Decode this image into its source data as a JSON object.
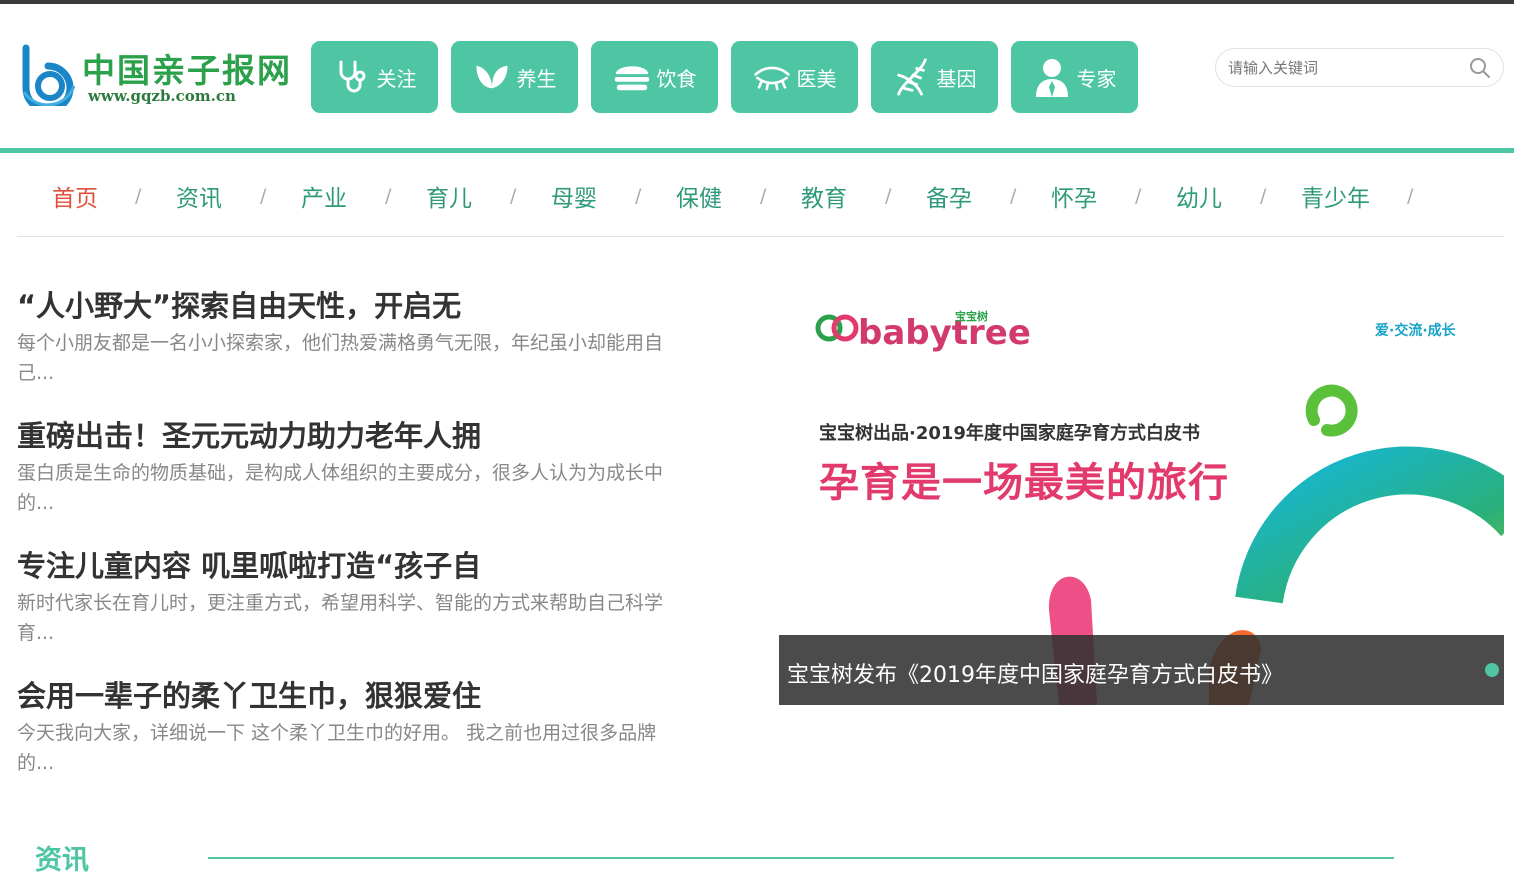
{
  "header": {
    "logo_cn": "中国亲子报网",
    "logo_url": "www.gqzb.com.cn",
    "categories": [
      {
        "label": "关注",
        "icon": "stethoscope-icon"
      },
      {
        "label": "养生",
        "icon": "leaves-icon"
      },
      {
        "label": "饮食",
        "icon": "burger-icon"
      },
      {
        "label": "医美",
        "icon": "eyelash-icon"
      },
      {
        "label": "基因",
        "icon": "dna-icon"
      },
      {
        "label": "专家",
        "icon": "doctor-icon"
      }
    ],
    "search": {
      "placeholder": "请输入关键词",
      "icon": "search-icon"
    }
  },
  "nav": {
    "items": [
      "首页",
      "资讯",
      "产业",
      "育儿",
      "母婴",
      "保健",
      "教育",
      "备孕",
      "怀孕",
      "幼儿",
      "青少年"
    ],
    "separator": "/"
  },
  "articles": [
    {
      "title": "“人小野大”探索自由天性，开启无",
      "summary": "每个小朋友都是一名小小探索家，他们热爱满格勇气无限，年纪虽小却能用自己..."
    },
    {
      "title": "重磅出击！圣元元动力助力老年人拥",
      "summary": "蛋白质是生命的物质基础，是构成人体组织的主要成分，很多人认为为成长中的..."
    },
    {
      "title": "专注儿童内容 叽里呱啦打造“孩子自",
      "summary": "新时代家长在育儿时，更注重方式，希望用科学、智能的方式来帮助自己科学育..."
    },
    {
      "title": "会用一辈子的柔丫卫生巾，狠狠爱住",
      "summary": "今天我向大家，详细说一下 这个柔丫卫生巾的好用。 我之前也用过很多品牌的..."
    }
  ],
  "banner": {
    "brand": "babytree",
    "brand_cn": "宝宝树",
    "tagline": "爱·交流·成长",
    "subtitle": "宝宝树出品·2019年度中国家庭孕育方式白皮书",
    "title": "孕育是一场最美的旅行",
    "caption": "宝宝树发布《2019年度中国家庭孕育方式白皮书》"
  },
  "section": {
    "title": "资讯"
  },
  "colors": {
    "accent": "#4ec6a3",
    "nav_text": "#2f9a7a",
    "nav_active": "#e0513d",
    "banner_title": "#e33a6d"
  }
}
